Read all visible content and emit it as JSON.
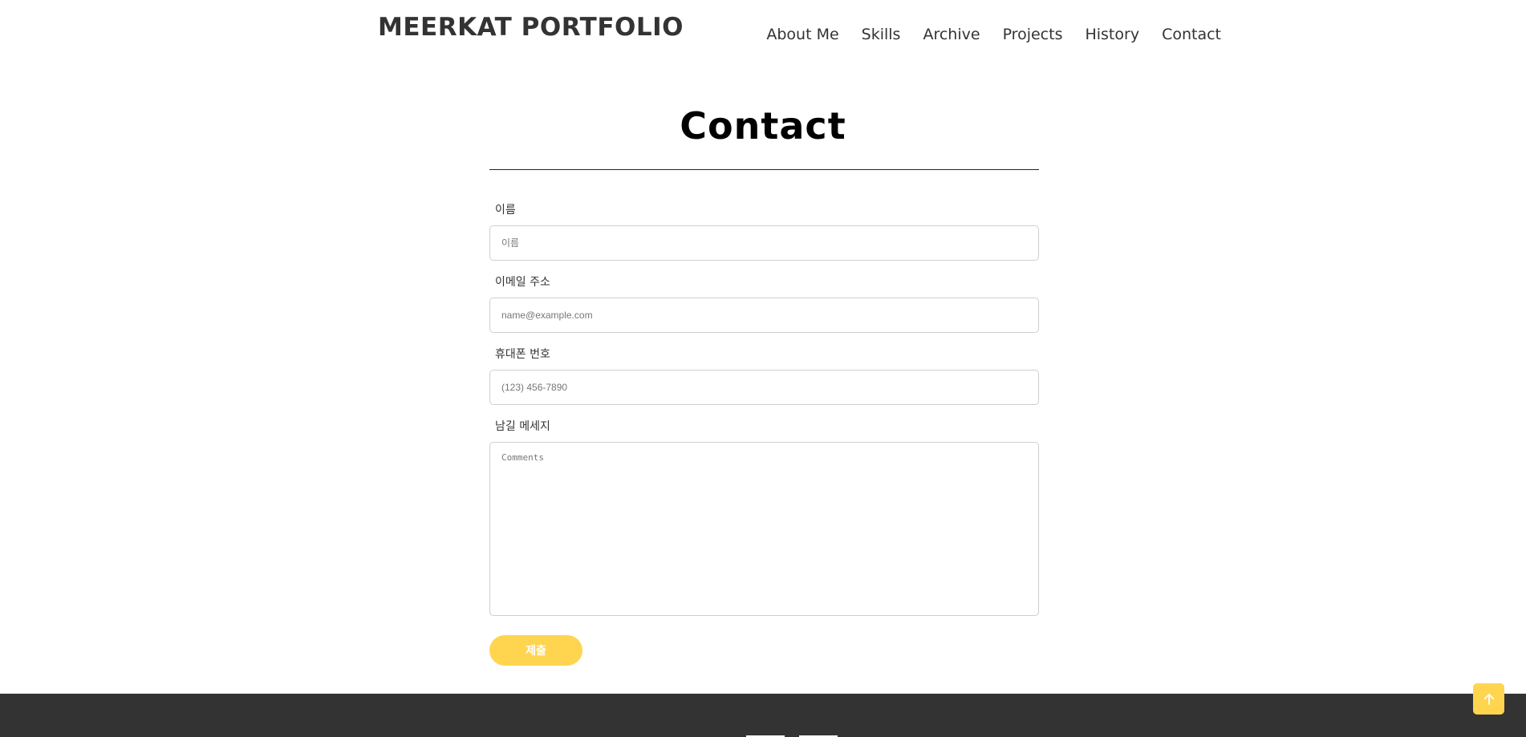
{
  "header": {
    "brand": "MEERKAT PORTFOLIO",
    "nav": [
      "About Me",
      "Skills",
      "Archive",
      "Projects",
      "History",
      "Contact"
    ]
  },
  "section": {
    "title": "Contact"
  },
  "form": {
    "name": {
      "label": "이름",
      "placeholder": "이름"
    },
    "email": {
      "label": "이메일 주소",
      "placeholder": "name@example.com"
    },
    "phone": {
      "label": "휴대폰 번호",
      "placeholder": "(123) 456-7890"
    },
    "message": {
      "label": "남길 메세지",
      "placeholder": "Comments"
    },
    "submit_label": "제출"
  },
  "colors": {
    "accent": "#ffd54f",
    "footer": "#333333",
    "text": "#333333"
  },
  "icons": {
    "scroll_top": "arrow-up-icon"
  }
}
